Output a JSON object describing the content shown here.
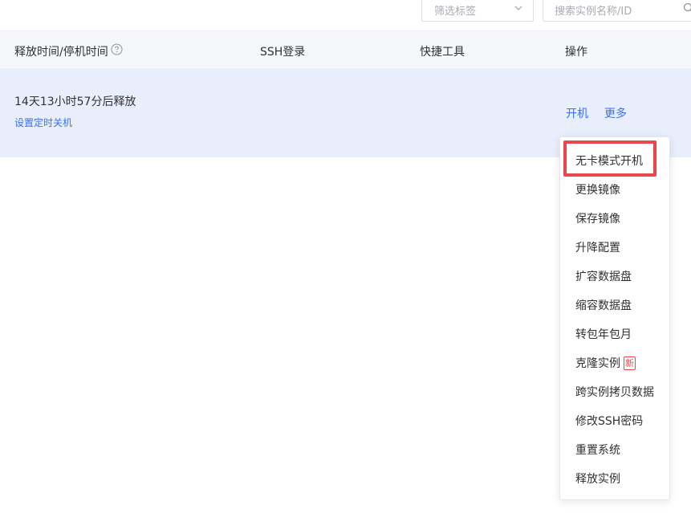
{
  "toolbar": {
    "tag_filter_placeholder": "筛选标签",
    "search_placeholder": "搜索实例名称/ID"
  },
  "table": {
    "headers": {
      "release_time": "释放时间/停机时间",
      "ssh_login": "SSH登录",
      "quick_tools": "快捷工具",
      "actions": "操作"
    },
    "row": {
      "release_text": "14天13小时57分后释放",
      "schedule_link": "设置定时关机",
      "power_on": "开机",
      "more": "更多"
    }
  },
  "menu": {
    "items": [
      "无卡模式开机",
      "更换镜像",
      "保存镜像",
      "升降配置",
      "扩容数据盘",
      "缩容数据盘",
      "转包年包月",
      "克隆实例",
      "跨实例拷贝数据",
      "修改SSH密码",
      "重置系统",
      "释放实例"
    ],
    "new_badge": "新"
  },
  "colors": {
    "link": "#3a6ff7",
    "row_bg": "#e8eefb",
    "header_bg": "#f5f7fa",
    "highlight": "#e8474c"
  }
}
